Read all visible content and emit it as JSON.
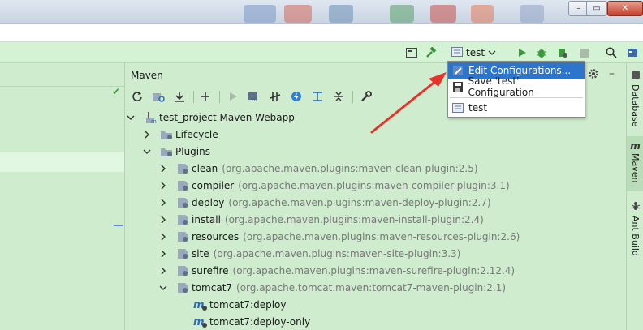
{
  "window": {
    "min_glyph": "–",
    "max_glyph": "▭",
    "close_glyph": "✕"
  },
  "toolbar": {
    "run_config": {
      "label": "test"
    }
  },
  "maven_panel": {
    "title": "Maven",
    "tree": {
      "root": {
        "label": "test_project Maven Webapp"
      },
      "lifecycle": {
        "label": "Lifecycle"
      },
      "plugins": {
        "label": "Plugins",
        "items": [
          {
            "name": "clean",
            "detail": "(org.apache.maven.plugins:maven-clean-plugin:2.5)"
          },
          {
            "name": "compiler",
            "detail": "(org.apache.maven.plugins:maven-compiler-plugin:3.1)"
          },
          {
            "name": "deploy",
            "detail": "(org.apache.maven.plugins:maven-deploy-plugin:2.7)"
          },
          {
            "name": "install",
            "detail": "(org.apache.maven.plugins:maven-install-plugin:2.4)"
          },
          {
            "name": "resources",
            "detail": "(org.apache.maven.plugins:maven-resources-plugin:2.6)"
          },
          {
            "name": "site",
            "detail": "(org.apache.maven.plugins:maven-site-plugin:3.3)"
          },
          {
            "name": "surefire",
            "detail": "(org.apache.maven.plugins:maven-surefire-plugin:2.12.4)"
          },
          {
            "name": "tomcat7",
            "detail": "(org.apache.tomcat.maven:tomcat7-maven-plugin:2.1)"
          }
        ],
        "tomcat7_goals": [
          "tomcat7:deploy",
          "tomcat7:deploy-only"
        ]
      }
    }
  },
  "popup": {
    "edit": "Edit Configurations...",
    "save": "Save 'test' Configuration",
    "test": "test"
  },
  "right_stripe": {
    "database": "Database",
    "maven": "Maven",
    "ant": "Ant Build"
  },
  "colors": {
    "background": "#cfeccf",
    "selection": "#2c74cc",
    "arrow": "#e8322b"
  }
}
